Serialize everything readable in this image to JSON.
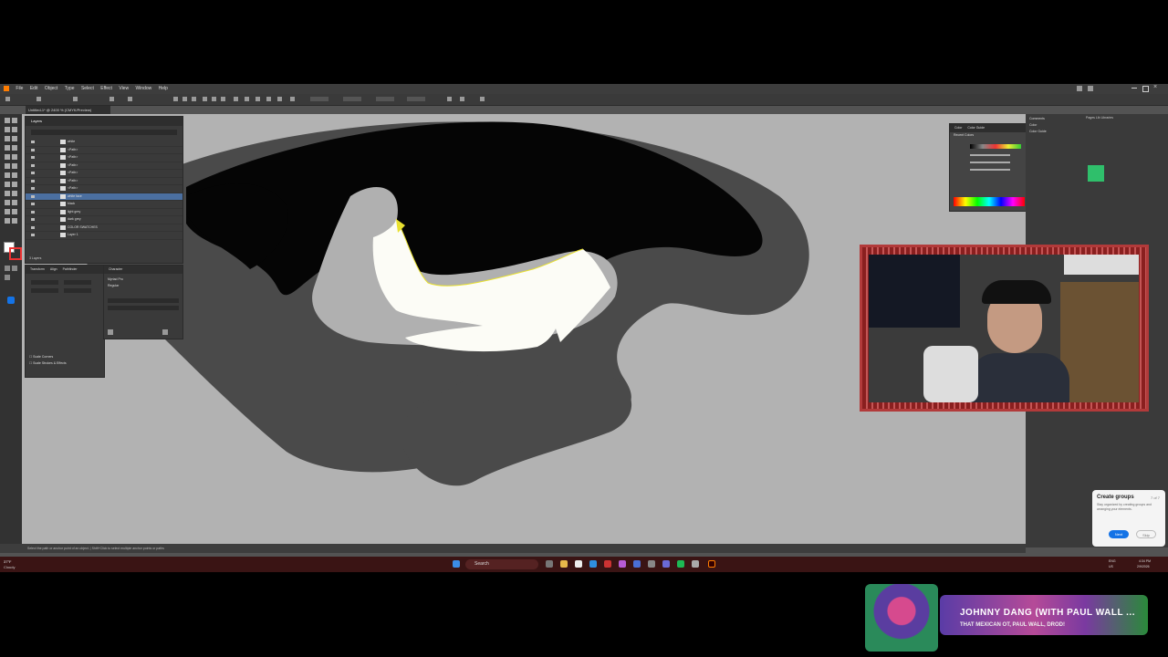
{
  "menu": [
    "File",
    "Edit",
    "Object",
    "Type",
    "Select",
    "Effect",
    "View",
    "Window",
    "Help"
  ],
  "document_tab": "Untitled-1* @ 2400 % (CMYK/Preview)",
  "layers_panel": {
    "tab": "Layers",
    "items": [
      {
        "name": "white"
      },
      {
        "name": "<Path>"
      },
      {
        "name": "<Path>"
      },
      {
        "name": "<Path>"
      },
      {
        "name": "<Path>"
      },
      {
        "name": "<Path>"
      },
      {
        "name": "<Path>"
      },
      {
        "name": "white face",
        "selected": true
      },
      {
        "name": "black"
      },
      {
        "name": "light grey"
      },
      {
        "name": "dark grey"
      },
      {
        "name": "COLOR SWATCHES"
      },
      {
        "name": "Layer 1"
      }
    ],
    "footer": "3 Layers"
  },
  "properties_panel": {
    "tabs": [
      "Transform",
      "Align",
      "Pathfinder"
    ],
    "checkboxes": [
      "Scale Corners",
      "Scale Strokes & Effects"
    ]
  },
  "character_panel": {
    "tab": "Character",
    "font": "Myriad Pro",
    "style": "Regular"
  },
  "color_panel": {
    "tabs": [
      "Color",
      "Color Guide"
    ],
    "label": "Recent Colors"
  },
  "right_panel": {
    "tabs": [
      "Comments",
      "Color",
      "Color Guide"
    ],
    "library_tabs": [
      "Pages",
      "Lib",
      "Libraries"
    ]
  },
  "status_text": "Select the path or anchor point of an object. | Shift+Click to select multiple anchor points or paths",
  "tooltip": {
    "title": "Create groups",
    "count": "7 of 7",
    "body": "Stay organized by creating groups and arranging your elements.",
    "next": "Next",
    "skip": "Skip"
  },
  "taskbar": {
    "weather": "37°F",
    "weather_sub": "Cloudy",
    "search": "Search",
    "lang": "ENG",
    "region": "US",
    "time": "4:34 PM",
    "date": "2/9/2026"
  },
  "now_playing": {
    "song": "JOHNNY DANG (WITH PAUL WALL ...",
    "artist": "THAT MEXICAN OT, PAUL WALL, DROD!"
  },
  "colors": {
    "accent_green": "#2fbf6b",
    "selection_blue": "#4b6fa0",
    "webcam_border": "#b23a3a"
  }
}
